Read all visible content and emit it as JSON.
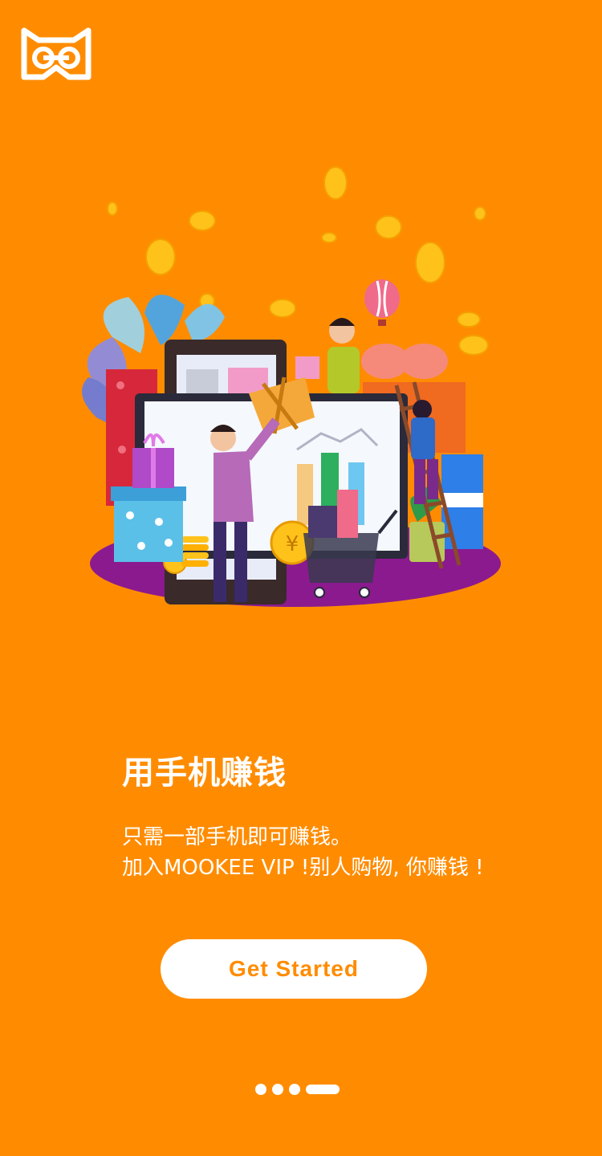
{
  "app": {
    "logo_icon": "mookee-cat-logo-icon"
  },
  "illustration": {
    "icon": "earn-money-shopping-illustration",
    "colors": {
      "floor": "#8B1A8F",
      "coin": "#FFC21A",
      "tablet": "#3A2A2A",
      "bars": [
        "#F5C97F",
        "#2EAE5F",
        "#6EC7F0"
      ]
    }
  },
  "onboarding": {
    "title": "用手机赚钱",
    "line1": "只需一部手机即可赚钱。",
    "line2": "加入MOOKEE VIP !别人购物, 你赚钱 !",
    "cta_label": "Get Started",
    "page_indicator": {
      "total": 4,
      "current": 4
    }
  },
  "colors": {
    "background": "#FF8C00",
    "text": "#FFFFFF",
    "accent": "#FF8C00",
    "button_bg": "#FFFFFF"
  }
}
